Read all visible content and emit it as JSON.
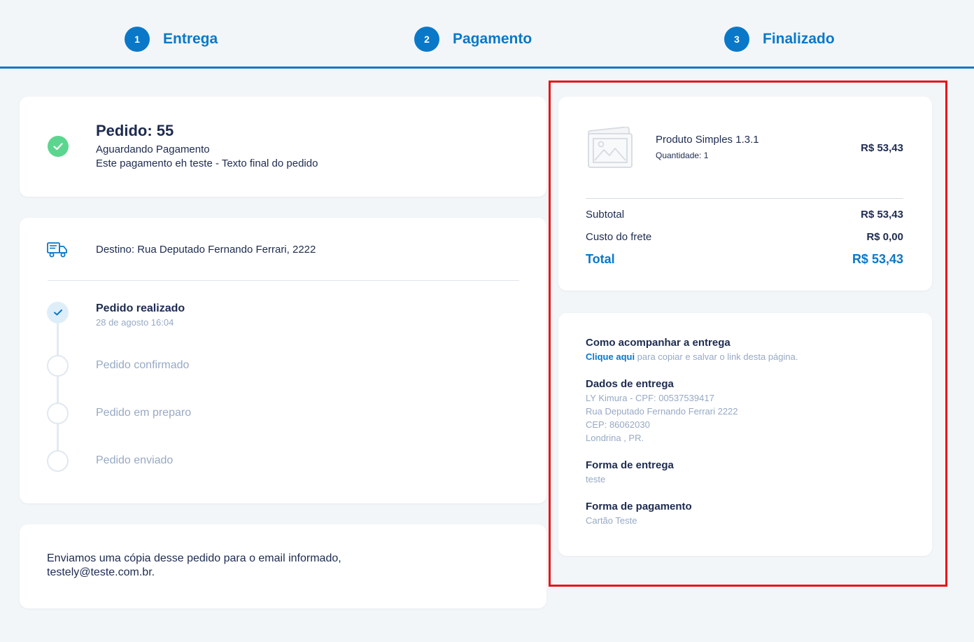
{
  "stepper": {
    "steps": [
      {
        "number": "1",
        "label": "Entrega"
      },
      {
        "number": "2",
        "label": "Pagamento"
      },
      {
        "number": "3",
        "label": "Finalizado"
      }
    ]
  },
  "status": {
    "title": "Pedido: 55",
    "state": "Aguardando Pagamento",
    "note": "Este pagamento eh teste - Texto final do pedido"
  },
  "tracking": {
    "destination": "Destino: Rua Deputado Fernando Ferrari, 2222",
    "steps": [
      {
        "label": "Pedido realizado",
        "date": "28 de agosto 16:04",
        "done": true
      },
      {
        "label": "Pedido confirmado",
        "done": false
      },
      {
        "label": "Pedido em preparo",
        "done": false
      },
      {
        "label": "Pedido enviado",
        "done": false
      }
    ]
  },
  "email": {
    "line1": "Enviamos uma cópia desse pedido para o email informado,",
    "line2": "testely@teste.com.br."
  },
  "summary": {
    "product": {
      "name": "Produto Simples 1.3.1",
      "quantity": "Quantidade: 1",
      "price": "R$ 53,43"
    },
    "subtotal_label": "Subtotal",
    "subtotal_value": "R$ 53,43",
    "shipping_label": "Custo do frete",
    "shipping_value": "R$ 0,00",
    "total_label": "Total",
    "total_value": "R$ 53,43"
  },
  "info": {
    "tracking_title": "Como acompanhar a entrega",
    "tracking_link": "Clique aqui",
    "tracking_text": " para copiar e salvar o link desta página.",
    "delivery_title": "Dados de entrega",
    "delivery_lines": [
      "LY Kimura - CPF: 00537539417",
      "Rua Deputado Fernando Ferrari 2222",
      "CEP: 86062030",
      "Londrina , PR."
    ],
    "shipping_method_title": "Forma de entrega",
    "shipping_method": "teste",
    "payment_method_title": "Forma de pagamento",
    "payment_method": "Cartão Teste"
  },
  "colors": {
    "accent": "#0a78c8",
    "success": "#5cd68f",
    "muted": "#97a9c4",
    "highlight_frame": "#e8141a"
  }
}
